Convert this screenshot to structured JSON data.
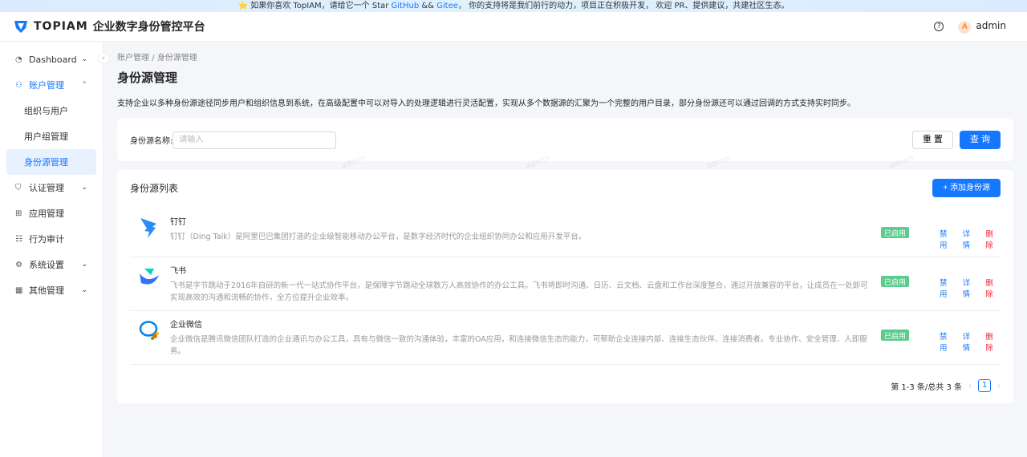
{
  "banner": {
    "star": "⭐",
    "pre": " 如果你喜欢 TopIAM，请给它一个 Star ",
    "github": "GitHub",
    "and": " && ",
    "gitee": "Gitee",
    "post": "， 你的支持将是我们前行的动力，项目正在积极开发， 欢迎 PR、提供建议，共建社区生态。"
  },
  "header": {
    "logo_text": "TOPIAM",
    "title": "企业数字身份管控平台",
    "user_initial": "A",
    "user": "admin"
  },
  "sidebar": {
    "items": [
      {
        "label": "Dashboard"
      },
      {
        "label": "账户管理"
      },
      {
        "label": "组织与用户"
      },
      {
        "label": "用户组管理"
      },
      {
        "label": "身份源管理"
      },
      {
        "label": "认证管理"
      },
      {
        "label": "应用管理"
      },
      {
        "label": "行为审计"
      },
      {
        "label": "系统设置"
      },
      {
        "label": "其他管理"
      }
    ]
  },
  "breadcrumb": [
    "账户管理",
    "/",
    "身份源管理"
  ],
  "page": {
    "title": "身份源管理",
    "desc": "支持企业以多种身份源途径同步用户和组织信息到系统，在高级配置中可以对导入的处理逻辑进行灵活配置，实现从多个数据源的汇聚为一个完整的用户目录，部分身份源还可以通过回调的方式支持实时同步。"
  },
  "search": {
    "label": "身份源名称:",
    "placeholder": "请输入",
    "reset": "重 置",
    "query": "查 询"
  },
  "list": {
    "title": "身份源列表",
    "add": "+ 添加身份源",
    "items": [
      {
        "name": "钉钉",
        "desc": "钉钉（Ding Talk）是阿里巴巴集团打造的企业级智能移动办公平台，是数字经济时代的企业组织协同办公和应用开发平台。",
        "status": "已启用",
        "disable": "禁用",
        "detail": "详情",
        "delete": "删除"
      },
      {
        "name": "飞书",
        "desc": "飞书是字节跳动于2016年自研的新一代一站式协作平台，是保障字节跳动全球数万人高效协作的办公工具。飞书将即时沟通、日历、云文档、云盘和工作台深度整合，通过开放兼容的平台，让成员在一处即可实现高效的沟通和流畅的协作，全方位提升企业效率。",
        "status": "已启用",
        "disable": "禁用",
        "detail": "详情",
        "delete": "删除"
      },
      {
        "name": "企业微信",
        "desc": "企业微信是腾讯微信团队打造的企业通讯与办公工具，具有与微信一致的沟通体验，丰富的OA应用，和连接微信生态的能力，可帮助企业连接内部、连接生态伙伴、连接消费者。专业协作、安全管理、人即服务。",
        "status": "已启用",
        "disable": "禁用",
        "detail": "详情",
        "delete": "删除"
      }
    ]
  },
  "pagination": {
    "summary": "第 1-3 条/总共 3 条",
    "prev": "‹",
    "page": "1",
    "next": "›"
  },
  "watermark": "admin"
}
